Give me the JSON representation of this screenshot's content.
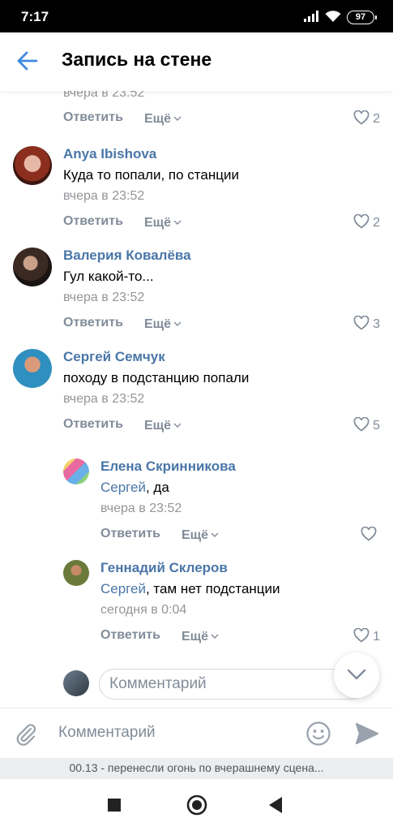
{
  "status_bar": {
    "time": "7:17",
    "battery": "97"
  },
  "header": {
    "title": "Запись на стене"
  },
  "actions": {
    "reply": "Ответить",
    "more": "Ещё"
  },
  "partial_comment": {
    "time": "вчера в 23:52",
    "likes": "2"
  },
  "comments": [
    {
      "author": "Anya Ibishova",
      "text": "Куда то попали, по станции",
      "time": "вчера в 23:52",
      "likes": "2"
    },
    {
      "author": "Валерия Ковалёва",
      "text": "Гул какой-то...",
      "time": "вчера в 23:52",
      "likes": "3"
    },
    {
      "author": "Сергей Семчук",
      "text": "походу в подстанцию попали",
      "time": "вчера в 23:52",
      "likes": "5"
    }
  ],
  "replies": [
    {
      "author": "Елена Скринникова",
      "mention": "Сергей",
      "text": ", да",
      "time": "вчера в 23:52",
      "likes": ""
    },
    {
      "author": "Геннадий Склеров",
      "mention": "Сергей",
      "text": ", там нет подстанции",
      "time": "сегодня в 0:04",
      "likes": "1"
    }
  ],
  "reply_input": {
    "placeholder": "Комментарий"
  },
  "composer": {
    "placeholder": "Комментарий"
  },
  "notice": {
    "text": "00.13 - перенесли огонь по вчерашнему сцена..."
  },
  "colors": {
    "link": "#4a76a8",
    "meta": "#939699",
    "action": "#818c99",
    "accent": "#3f8ae0"
  },
  "icons": [
    "back-arrow-icon",
    "heart-icon",
    "chevron-down-icon",
    "paperclip-icon",
    "smile-icon",
    "send-icon"
  ]
}
